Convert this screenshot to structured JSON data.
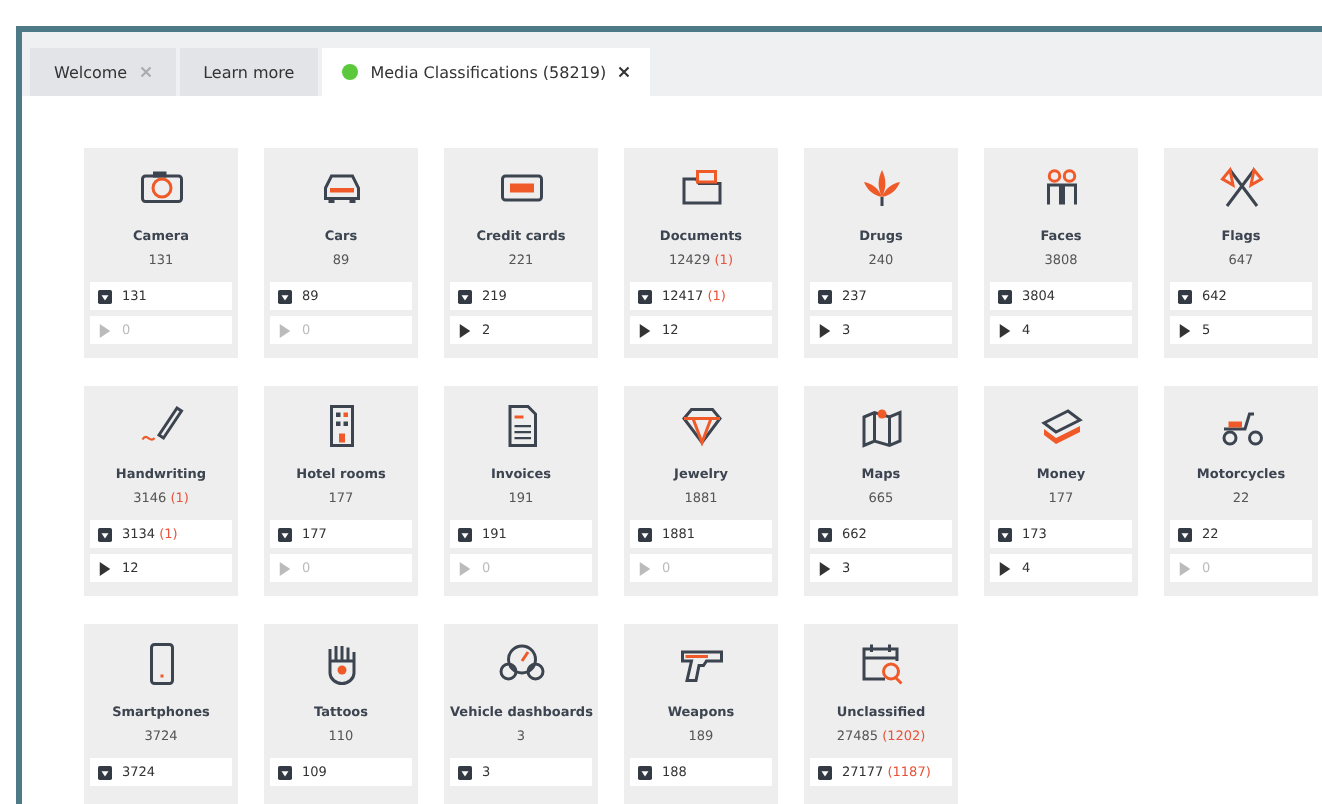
{
  "tabs": [
    {
      "label": "Welcome",
      "selected": false,
      "closable": true
    },
    {
      "label": "Learn more",
      "selected": false,
      "closable": false
    },
    {
      "label": "Media Classifications (58219)",
      "selected": true,
      "closable": true,
      "color": "#5cc93c"
    }
  ],
  "categories": [
    {
      "name": "Camera",
      "count": "131",
      "images": {
        "count": "131"
      },
      "videos": {
        "count": "0",
        "dimmed": true
      }
    },
    {
      "name": "Cars",
      "count": "89",
      "images": {
        "count": "89"
      },
      "videos": {
        "count": "0",
        "dimmed": true
      }
    },
    {
      "name": "Credit cards",
      "count": "221",
      "images": {
        "count": "219"
      },
      "videos": {
        "count": "2",
        "dimmed": false
      }
    },
    {
      "name": "Documents",
      "count": "12429",
      "count_extra": "(1)",
      "images": {
        "count": "12417",
        "extra": "(1)"
      },
      "videos": {
        "count": "12",
        "dimmed": false
      }
    },
    {
      "name": "Drugs",
      "count": "240",
      "images": {
        "count": "237"
      },
      "videos": {
        "count": "3",
        "dimmed": false
      }
    },
    {
      "name": "Faces",
      "count": "3808",
      "images": {
        "count": "3804"
      },
      "videos": {
        "count": "4",
        "dimmed": false
      }
    },
    {
      "name": "Flags",
      "count": "647",
      "images": {
        "count": "642"
      },
      "videos": {
        "count": "5",
        "dimmed": false
      }
    },
    {
      "name": "Handwriting",
      "count": "3146",
      "count_extra": "(1)",
      "images": {
        "count": "3134",
        "extra": "(1)"
      },
      "videos": {
        "count": "12",
        "dimmed": false
      }
    },
    {
      "name": "Hotel rooms",
      "count": "177",
      "images": {
        "count": "177"
      },
      "videos": {
        "count": "0",
        "dimmed": true
      }
    },
    {
      "name": "Invoices",
      "count": "191",
      "images": {
        "count": "191"
      },
      "videos": {
        "count": "0",
        "dimmed": true
      }
    },
    {
      "name": "Jewelry",
      "count": "1881",
      "images": {
        "count": "1881"
      },
      "videos": {
        "count": "0",
        "dimmed": true
      }
    },
    {
      "name": "Maps",
      "count": "665",
      "images": {
        "count": "662"
      },
      "videos": {
        "count": "3",
        "dimmed": false
      }
    },
    {
      "name": "Money",
      "count": "177",
      "images": {
        "count": "173"
      },
      "videos": {
        "count": "4",
        "dimmed": false
      }
    },
    {
      "name": "Motorcycles",
      "count": "22",
      "images": {
        "count": "22"
      },
      "videos": {
        "count": "0",
        "dimmed": true
      }
    },
    {
      "name": "Smartphones",
      "count": "3724",
      "images": {
        "count": "3724"
      }
    },
    {
      "name": "Tattoos",
      "count": "110",
      "images": {
        "count": "109"
      }
    },
    {
      "name": "Vehicle dashboards",
      "count": "3",
      "images": {
        "count": "3"
      }
    },
    {
      "name": "Weapons",
      "count": "189",
      "images": {
        "count": "188"
      }
    },
    {
      "name": "Unclassified",
      "count": "27485",
      "count_extra": "(1202)",
      "images": {
        "count": "27177",
        "extra": "(1187)"
      }
    }
  ]
}
